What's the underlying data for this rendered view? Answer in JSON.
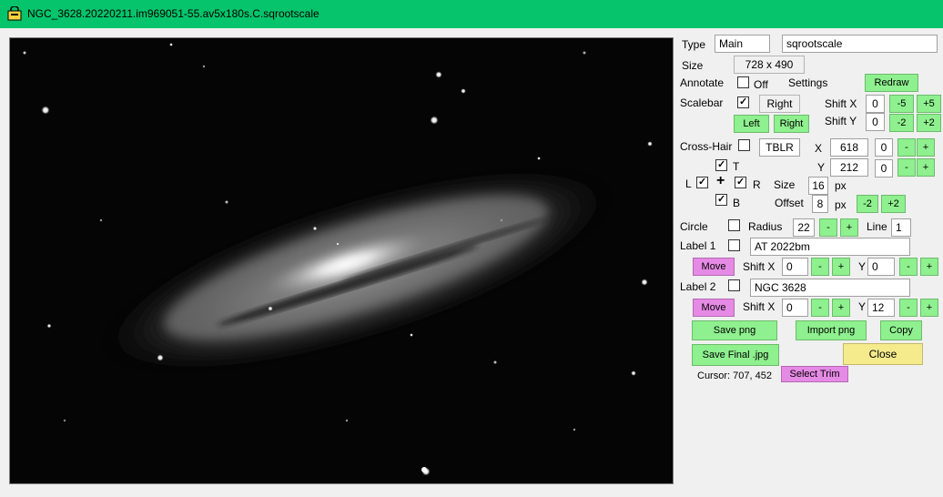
{
  "window": {
    "title": "NGC_3628.20220211.im969051-55.av5x180s.C.sqrootscale"
  },
  "colors": {
    "titlebar": "#05c46b",
    "button_green": "#8ef08e",
    "button_pink": "#e58ae5",
    "button_yellow": "#f5eb8c"
  },
  "panel": {
    "type_label": "Type",
    "type_value": "Main",
    "scale_value": "sqrootscale",
    "size_label": "Size",
    "size_value": "728 x 490",
    "annotate_label": "Annotate",
    "annotate_off_label": "Off",
    "settings_label": "Settings",
    "redraw_label": "Redraw",
    "scalebar_label": "Scalebar",
    "scalebar_position": "Right",
    "shift_x_label": "Shift X",
    "shift_x_value": "0",
    "shift_x_minus": "-5",
    "shift_x_plus": "+5",
    "shift_y_label": "Shift Y",
    "shift_y_value": "0",
    "shift_y_minus": "-2",
    "shift_y_plus": "+2",
    "left_label": "Left",
    "right_label": "Right",
    "crosshair_label": "Cross-Hair",
    "crosshair_mode": "TBLR",
    "x_label": "X",
    "x_value": "618",
    "x_offset": "0",
    "y_label": "Y",
    "y_value": "212",
    "y_offset": "0",
    "minus": "-",
    "plus": "+",
    "t_label": "T",
    "l_label": "L",
    "cross_symbol": "+",
    "r_label": "R",
    "b_label": "B",
    "size2_label": "Size",
    "size2_value": "16",
    "px_label": "px",
    "offset_label": "Offset",
    "offset_value": "8",
    "offset_minus": "-2",
    "offset_plus": "+2",
    "circle_label": "Circle",
    "radius_label": "Radius",
    "radius_value": "22",
    "line_label": "Line",
    "line_value": "1",
    "label1_label": "Label 1",
    "label1_value": "AT 2022bm",
    "move_label": "Move",
    "label1_shift_x": "0",
    "label1_shift_y": "0",
    "label2_label": "Label 2",
    "label2_value": "NGC 3628",
    "label2_shift_x": "0",
    "label2_shift_y": "12",
    "save_png_label": "Save png",
    "import_png_label": "Import png",
    "copy_label": "Copy",
    "save_final_label": "Save Final .jpg",
    "close_label": "Close",
    "cursor_text": "Cursor: 707, 452",
    "select_trim_label": "Select Trim"
  },
  "checkboxes": {
    "annotate": false,
    "scalebar": true,
    "crosshair": false,
    "t": true,
    "l": true,
    "r": true,
    "b": true,
    "circle": false,
    "label1": false,
    "label2": false
  }
}
